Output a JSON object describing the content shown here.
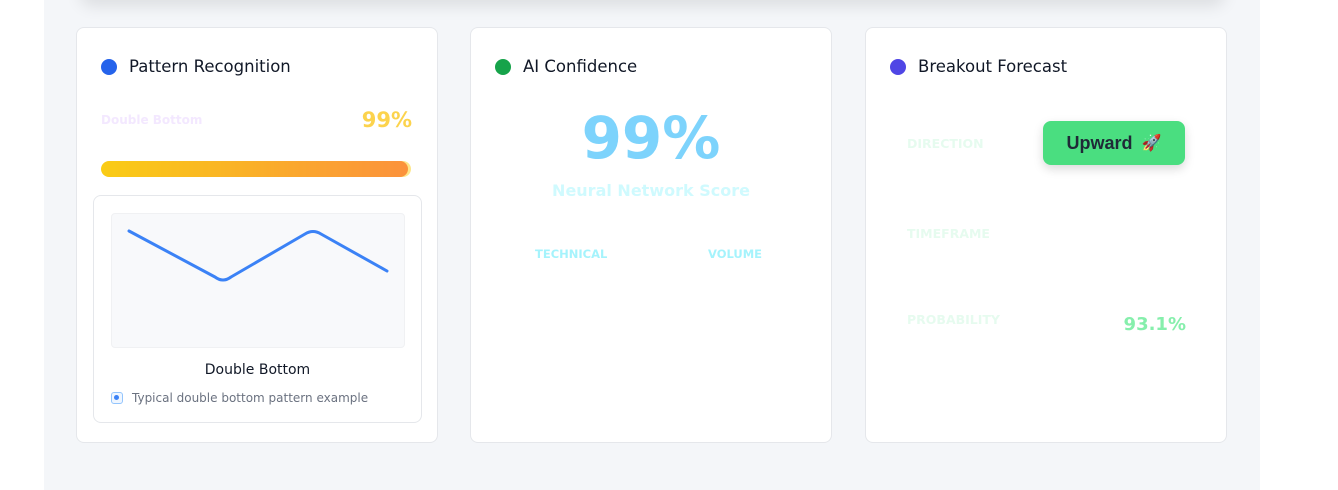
{
  "colors": {
    "pattern_dot": "#2563eb",
    "confidence_dot": "#16a34a",
    "breakout_dot": "#4f46e5",
    "line": "#3b82f6"
  },
  "pattern": {
    "title": "Pattern Recognition",
    "pattern_name": "Double Bottom",
    "confidence_pct": "99%",
    "progress_fraction": 0.99,
    "example": {
      "title": "Double Bottom",
      "caption": "Typical double bottom pattern example",
      "icon": "info-icon"
    }
  },
  "confidence": {
    "title": "AI Confidence",
    "score": "99%",
    "score_label": "Neural Network Score",
    "metrics": [
      "TECHNICAL",
      "VOLUME"
    ]
  },
  "breakout": {
    "title": "Breakout Forecast",
    "direction_label": "DIRECTION",
    "direction_value": "Upward",
    "direction_icon": "rocket-icon",
    "timeframe_label": "TIMEFRAME",
    "probability_label": "PROBABILITY",
    "probability_value": "93.1%"
  }
}
